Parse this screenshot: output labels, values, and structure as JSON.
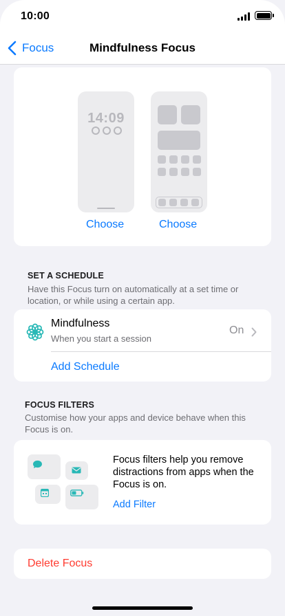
{
  "status_bar": {
    "time": "10:00"
  },
  "nav": {
    "back_label": "Focus",
    "title": "Mindfulness Focus"
  },
  "wallpaper": {
    "lock_time": "14:09",
    "lock_choose_label": "Choose",
    "home_choose_label": "Choose"
  },
  "schedule_section": {
    "header": "SET A SCHEDULE",
    "description": "Have this Focus turn on automatically at a set time or location, or while using a certain app.",
    "item": {
      "title": "Mindfulness",
      "subtitle": "When you start a session",
      "status": "On",
      "icon": "flower-icon"
    },
    "add_label": "Add Schedule"
  },
  "filters_section": {
    "header": "FOCUS FILTERS",
    "description": "Customise how your apps and device behave when this Focus is on.",
    "info": "Focus filters help you remove distractions from apps when the Focus is on.",
    "add_label": "Add Filter"
  },
  "delete": {
    "label": "Delete Focus"
  },
  "colors": {
    "accent": "#0a7aff",
    "teal": "#28b8b6",
    "destructive": "#ff3b30",
    "background": "#f2f2f7"
  }
}
